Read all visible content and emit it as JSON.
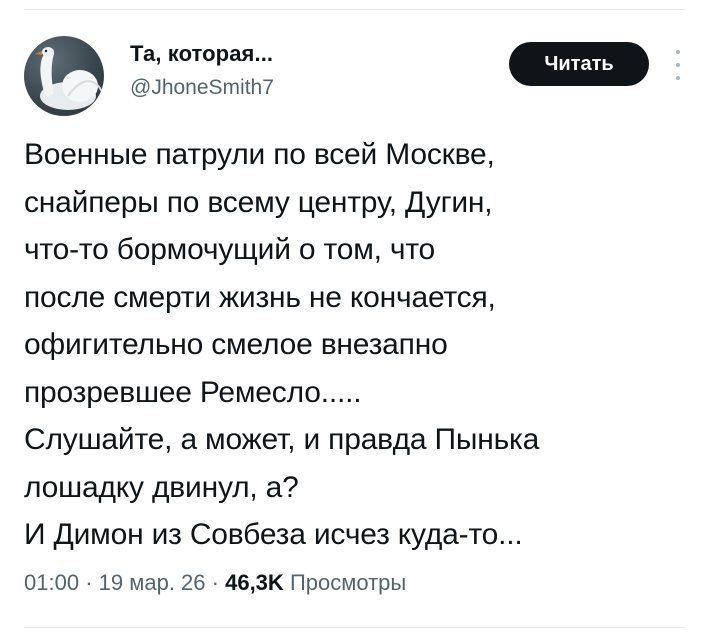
{
  "author": {
    "display_name": "Та, которая...",
    "handle": "@JhoneSmith7"
  },
  "actions": {
    "follow_label": "Читать"
  },
  "icons": {
    "more": "vertical-ellipsis-icon",
    "avatar": "swan-avatar"
  },
  "tweet": {
    "lines": [
      "Военные патрули по всей Москве,",
      "снайперы по всему центру, Дугин,",
      "что-то бормочущий о том, что",
      "после смерти жизнь не кончается,",
      "офигительно смелое внезапно",
      "прозревшее Ремесло.....",
      "Слушайте, а может, и правда Пынька",
      "лошадку двинул, а?",
      "И Димон из Совбеза исчез куда-то..."
    ]
  },
  "meta": {
    "time": "01:00",
    "separator": "·",
    "date": "19 мар. 26",
    "views_count": "46,3K",
    "views_label": "Просмотры"
  },
  "colors": {
    "text": "#0f1419",
    "secondary_text": "#536471",
    "button_bg": "#0f1419",
    "button_text": "#ffffff",
    "divider": "#e6e9ec"
  }
}
